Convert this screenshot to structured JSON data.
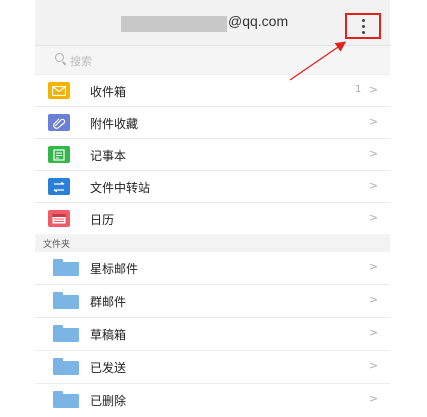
{
  "header": {
    "email_domain": "@qq.com",
    "more_icon": "vertical-ellipsis-icon"
  },
  "search": {
    "placeholder": "搜索",
    "icon": "search-icon"
  },
  "items": [
    {
      "label": "收件箱",
      "count": "1",
      "chevron": ">",
      "icon": "inbox-icon",
      "color": "#f5b300"
    },
    {
      "label": "附件收藏",
      "count": "",
      "chevron": ">",
      "icon": "paperclip-icon",
      "color": "#6b7fd7"
    },
    {
      "label": "记事本",
      "count": "",
      "chevron": ">",
      "icon": "notepad-icon",
      "color": "#35b64a"
    },
    {
      "label": "文件中转站",
      "count": "",
      "chevron": ">",
      "icon": "transfer-station-icon",
      "color": "#2b7fd6"
    },
    {
      "label": "日历",
      "count": "",
      "chevron": ">",
      "icon": "calendar-icon",
      "color": "#ef5b67"
    }
  ],
  "folders_section": {
    "title": "文件夹"
  },
  "folders": [
    {
      "label": "星标邮件",
      "chevron": ">"
    },
    {
      "label": "群邮件",
      "chevron": ">"
    },
    {
      "label": "草稿箱",
      "chevron": ">"
    },
    {
      "label": "已发送",
      "chevron": ">"
    },
    {
      "label": "已删除",
      "chevron": ">"
    }
  ],
  "annotation": {
    "highlight_color": "#e0211d"
  }
}
